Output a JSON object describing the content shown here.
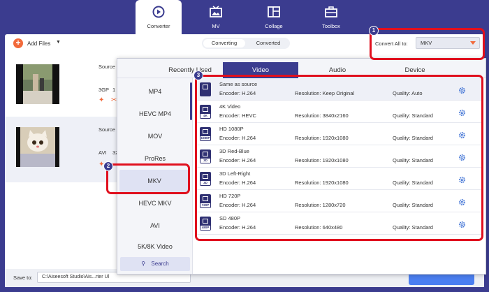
{
  "nav": {
    "tabs": [
      {
        "label": "Converter",
        "icon": "converter-icon"
      },
      {
        "label": "MV",
        "icon": "mv-icon"
      },
      {
        "label": "Collage",
        "icon": "collage-icon"
      },
      {
        "label": "Toolbox",
        "icon": "toolbox-icon"
      }
    ]
  },
  "toolbar": {
    "add_files_label": "Add Files",
    "segments": [
      "Converting",
      "Converted"
    ],
    "convert_all_label": "Convert All to:",
    "convert_all_value": "MKV"
  },
  "files": [
    {
      "source_label": "Source",
      "format": "3GP",
      "format_tail": "1"
    },
    {
      "source_label": "Source",
      "format": "AVI",
      "format_tail": "32"
    }
  ],
  "bottom": {
    "save_to_label": "Save to:",
    "save_path": "C:\\Aiseesoft Studio\\Ais...rter Ul"
  },
  "popup": {
    "tabs": [
      "Recently Used",
      "Video",
      "Audio",
      "Device"
    ],
    "active_tab": "Video",
    "formats": [
      "MP4",
      "HEVC MP4",
      "MOV",
      "ProRes",
      "MKV",
      "HEVC MKV",
      "AVI",
      "5K/8K Video"
    ],
    "active_format": "MKV",
    "search_label": "Search",
    "presets": [
      {
        "name": "Same as source",
        "encoder": "Encoder: H.264",
        "resolution": "Resolution: Keep Original",
        "quality": "Quality: Auto",
        "tag": ""
      },
      {
        "name": "4K Video",
        "encoder": "Encoder: HEVC",
        "resolution": "Resolution: 3840x2160",
        "quality": "Quality: Standard",
        "tag": "4K"
      },
      {
        "name": "HD 1080P",
        "encoder": "Encoder: H.264",
        "resolution": "Resolution: 1920x1080",
        "quality": "Quality: Standard",
        "tag": "1080P"
      },
      {
        "name": "3D Red-Blue",
        "encoder": "Encoder: H.264",
        "resolution": "Resolution: 1920x1080",
        "quality": "Quality: Standard",
        "tag": "3D"
      },
      {
        "name": "3D Left-Right",
        "encoder": "Encoder: H.264",
        "resolution": "Resolution: 1920x1080",
        "quality": "Quality: Standard",
        "tag": "3D"
      },
      {
        "name": "HD 720P",
        "encoder": "Encoder: H.264",
        "resolution": "Resolution: 1280x720",
        "quality": "Quality: Standard",
        "tag": "720P"
      },
      {
        "name": "SD 480P",
        "encoder": "Encoder: H.264",
        "resolution": "Resolution: 640x480",
        "quality": "Quality: Standard",
        "tag": "480P"
      }
    ]
  },
  "annotations": {
    "badges": [
      "1",
      "2",
      "3"
    ]
  },
  "colors": {
    "brand": "#3b3c8f",
    "accent": "#f26a3b",
    "highlight": "#e0101e",
    "button_blue": "#4b7ff1"
  }
}
